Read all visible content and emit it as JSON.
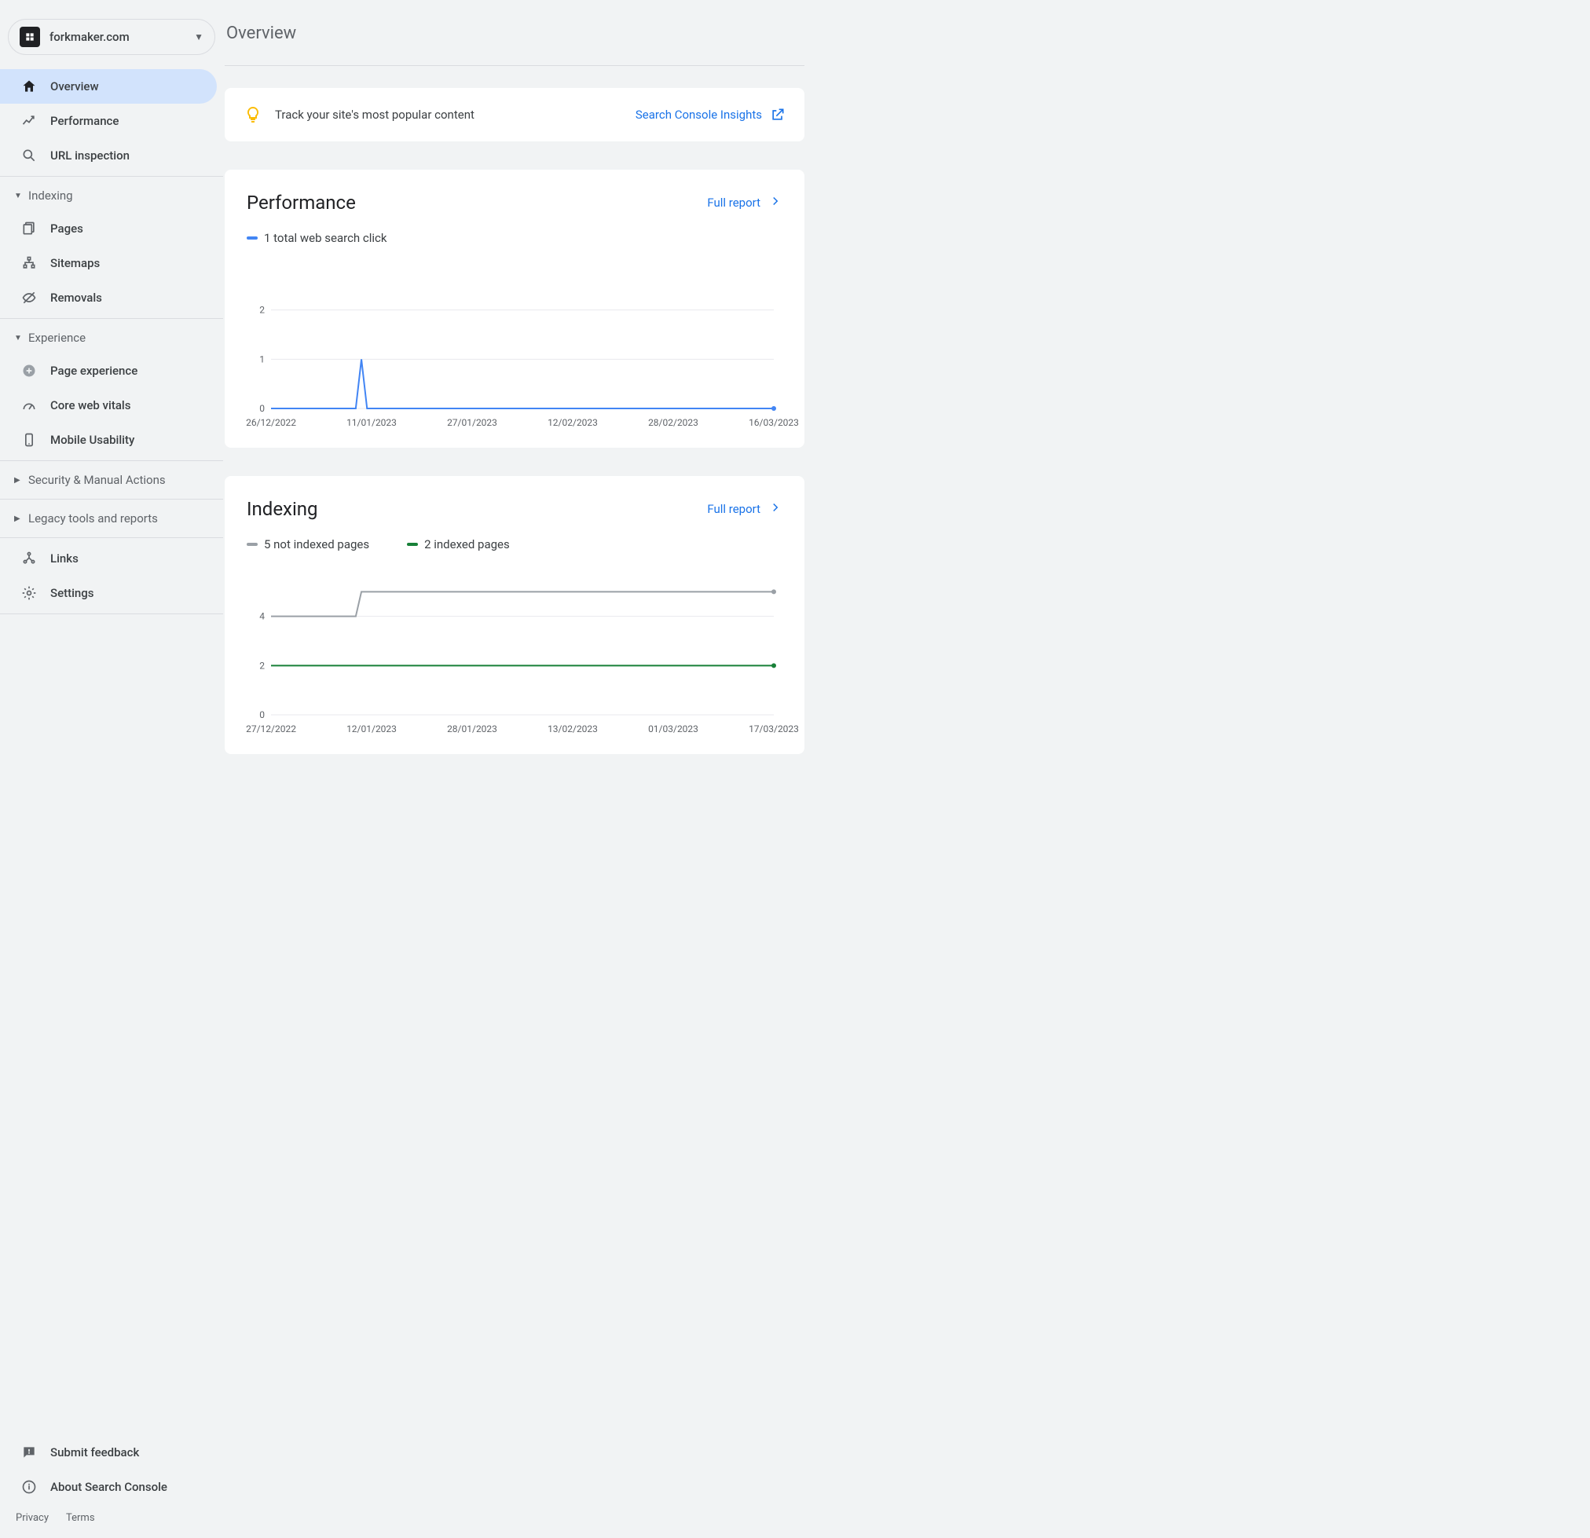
{
  "property": {
    "name": "forkmaker.com"
  },
  "sidebar": {
    "overview": "Overview",
    "performance": "Performance",
    "url_inspection": "URL inspection",
    "indexing_header": "Indexing",
    "pages": "Pages",
    "sitemaps": "Sitemaps",
    "removals": "Removals",
    "experience_header": "Experience",
    "page_experience": "Page experience",
    "core_web_vitals": "Core web vitals",
    "mobile_usability": "Mobile Usability",
    "security_header": "Security & Manual Actions",
    "legacy_header": "Legacy tools and reports",
    "links": "Links",
    "settings": "Settings",
    "submit_feedback": "Submit feedback",
    "about": "About Search Console"
  },
  "footer": {
    "privacy": "Privacy",
    "terms": "Terms"
  },
  "page": {
    "title": "Overview"
  },
  "insights": {
    "text": "Track your site's most popular content",
    "link": "Search Console Insights"
  },
  "performance_panel": {
    "title": "Performance",
    "full_report": "Full report",
    "legend_clicks": "1 total web search click"
  },
  "indexing_panel": {
    "title": "Indexing",
    "full_report": "Full report",
    "legend_not_indexed": "5 not indexed pages",
    "legend_indexed": "2 indexed pages"
  },
  "chart_data": [
    {
      "type": "line",
      "title": "Performance",
      "ylabel": "",
      "xlabel": "",
      "ylim": [
        0,
        3
      ],
      "x": [
        "26/12/2022",
        "11/01/2023",
        "27/01/2023",
        "12/02/2023",
        "28/02/2023",
        "16/03/2023"
      ],
      "series": [
        {
          "name": "total web search clicks",
          "color": "#4285f4",
          "values": [
            0,
            0,
            0,
            0,
            0,
            0,
            0,
            0,
            0,
            0,
            0,
            0,
            0,
            0,
            0,
            0,
            1,
            0,
            0,
            0,
            0,
            0,
            0,
            0,
            0,
            0,
            0,
            0,
            0,
            0,
            0,
            0,
            0,
            0,
            0,
            0,
            0,
            0,
            0,
            0,
            0,
            0,
            0,
            0,
            0,
            0,
            0,
            0,
            0,
            0,
            0,
            0,
            0,
            0,
            0,
            0,
            0,
            0,
            0,
            0,
            0,
            0,
            0,
            0,
            0,
            0,
            0,
            0,
            0,
            0,
            0,
            0,
            0,
            0,
            0,
            0,
            0,
            0,
            0,
            0,
            0,
            0,
            0,
            0,
            0,
            0,
            0,
            0,
            0,
            0
          ]
        }
      ]
    },
    {
      "type": "line",
      "title": "Indexing",
      "ylabel": "",
      "xlabel": "",
      "ylim": [
        0,
        6
      ],
      "x": [
        "27/12/2022",
        "12/01/2023",
        "28/01/2023",
        "13/02/2023",
        "01/03/2023",
        "17/03/2023"
      ],
      "series": [
        {
          "name": "not indexed pages",
          "color": "#9aa0a6",
          "values": [
            4,
            4,
            4,
            4,
            4,
            4,
            4,
            4,
            4,
            4,
            4,
            4,
            4,
            4,
            4,
            4,
            5,
            5,
            5,
            5,
            5,
            5,
            5,
            5,
            5,
            5,
            5,
            5,
            5,
            5,
            5,
            5,
            5,
            5,
            5,
            5,
            5,
            5,
            5,
            5,
            5,
            5,
            5,
            5,
            5,
            5,
            5,
            5,
            5,
            5,
            5,
            5,
            5,
            5,
            5,
            5,
            5,
            5,
            5,
            5,
            5,
            5,
            5,
            5,
            5,
            5,
            5,
            5,
            5,
            5,
            5,
            5,
            5,
            5,
            5,
            5,
            5,
            5,
            5,
            5,
            5,
            5,
            5,
            5,
            5,
            5,
            5,
            5,
            5,
            5
          ]
        },
        {
          "name": "indexed pages",
          "color": "#188038",
          "values": [
            2,
            2,
            2,
            2,
            2,
            2,
            2,
            2,
            2,
            2,
            2,
            2,
            2,
            2,
            2,
            2,
            2,
            2,
            2,
            2,
            2,
            2,
            2,
            2,
            2,
            2,
            2,
            2,
            2,
            2,
            2,
            2,
            2,
            2,
            2,
            2,
            2,
            2,
            2,
            2,
            2,
            2,
            2,
            2,
            2,
            2,
            2,
            2,
            2,
            2,
            2,
            2,
            2,
            2,
            2,
            2,
            2,
            2,
            2,
            2,
            2,
            2,
            2,
            2,
            2,
            2,
            2,
            2,
            2,
            2,
            2,
            2,
            2,
            2,
            2,
            2,
            2,
            2,
            2,
            2,
            2,
            2,
            2,
            2,
            2,
            2,
            2,
            2,
            2,
            2
          ]
        }
      ]
    }
  ]
}
